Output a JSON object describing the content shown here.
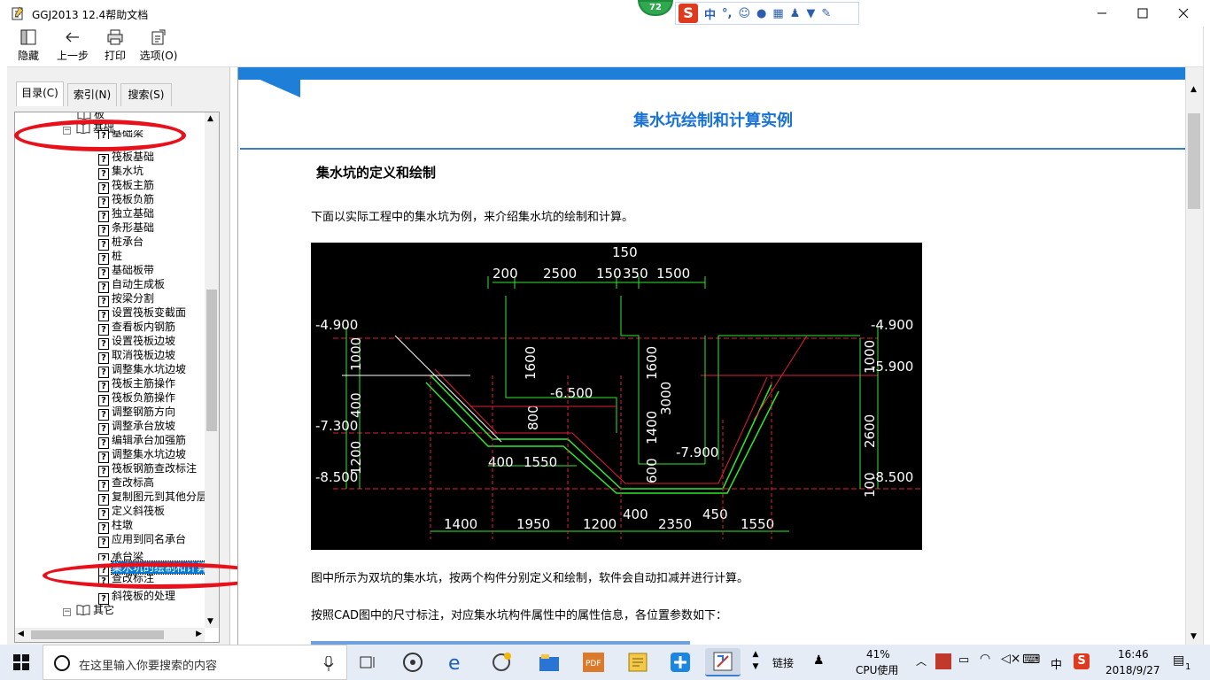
{
  "window": {
    "title": "GGJ2013 12.4帮助文档"
  },
  "ime": {
    "badge": "72",
    "logo": "S",
    "lang": "中",
    "punct": "°,"
  },
  "toolbar": {
    "hide_label": "隐藏",
    "back_label": "上一步",
    "print_label": "打印",
    "options_label": "选项(O)"
  },
  "tabs": {
    "contents": "目录(C)",
    "index": "索引(N)",
    "search": "搜索(S)"
  },
  "tree": {
    "prev_partial": "板",
    "folder_foundation": "基础",
    "partial_first": "基础梁",
    "items": [
      "筏板基础",
      "集水坑",
      "筏板主筋",
      "筏板负筋",
      "独立基础",
      "条形基础",
      "桩承台",
      "桩",
      "基础板带",
      "自动生成板",
      "按梁分割",
      "设置筏板变截面",
      "查看板内钢筋",
      "设置筏板边坡",
      "取消筏板边坡",
      "调整集水坑边坡",
      "筏板主筋操作",
      "筏板负筋操作",
      "调整钢筋方向",
      "调整承台放坡",
      "编辑承台加强筋",
      "调整集水坑边坡",
      "筏板钢筋查改标注",
      "查改标高",
      "复制图元到其他分层",
      "定义斜筏板",
      "柱墩",
      "应用到同名承台"
    ],
    "partial_before_selected": "承台梁",
    "selected": "集水坑的绘制和计算",
    "after_selected": [
      "查改标注",
      "斜筏板的处理"
    ],
    "folder_other": "其它"
  },
  "content": {
    "heading": "集水坑绘制和计算实例",
    "section_title": "集水坑的定义和绘制",
    "para1": "下面以实际工程中的集水坑为例，来介绍集水坑的绘制和计算。",
    "para2": "图中所示为双坑的集水坑，按两个构件分别定义和绘制，软件会自动扣减并进行计算。",
    "para3": "按照CAD图中的尺寸标注，对应集水坑构件属性中的属性信息，各位置参数如下："
  },
  "cad": {
    "top_dims": [
      "200",
      "2500",
      "150",
      "350",
      "1500"
    ],
    "top_dim_mid": "150",
    "elev_left_1": "-4.900",
    "elev_left_2": "-7.300",
    "elev_left_3": "-8.500",
    "elev_right_1": "-4.900",
    "elev_right_2": "-5.900",
    "elev_right_3": "-8.500",
    "elev_mid": "-6.500",
    "elev_low": "-7.900",
    "vert_left": [
      "1000",
      "400",
      "1200"
    ],
    "vert_mid1": "1600",
    "vert_mid2": "800",
    "vert_mid3": "1600",
    "vert_mid4": "3000",
    "vert_mid5": "1400",
    "vert_mid6": "600",
    "vert_right": [
      "1000",
      "2600",
      "100"
    ],
    "inner_dims": [
      "400",
      "1550"
    ],
    "bottom_dims": [
      "1400",
      "1950",
      "1200",
      "400",
      "2350",
      "450",
      "1550"
    ]
  },
  "taskbar": {
    "search_placeholder": "在这里输入你要搜索的内容",
    "links_label": "链接",
    "cpu_percent": "41%",
    "cpu_label": "CPU使用",
    "ime_lang": "中",
    "time": "16:46",
    "date": "2018/9/27",
    "notifications": "1"
  },
  "colors": {
    "accent_blue": "#1973d6",
    "selection": "#0078d7",
    "ellipse_red": "#e8101a",
    "cad_green": "#2ee82e",
    "cad_red": "#e0203a",
    "cad_cyan": "#30e0e0",
    "cad_white": "#ffffff"
  }
}
